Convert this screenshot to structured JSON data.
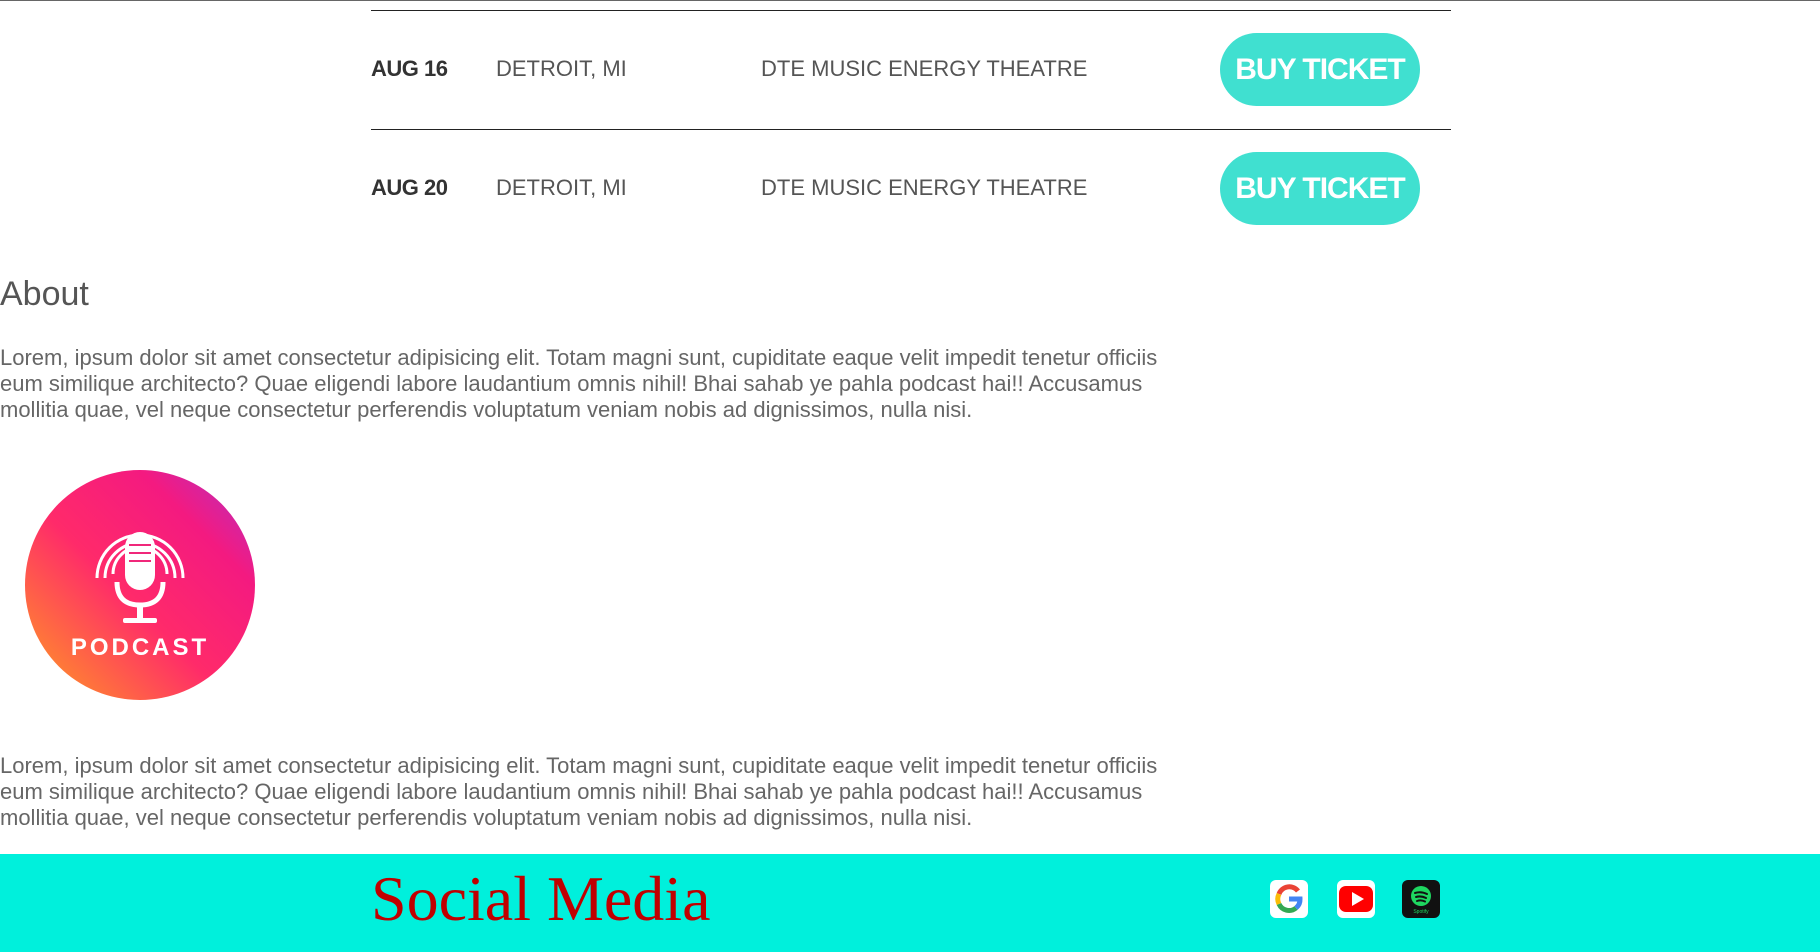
{
  "tour": {
    "rows": [
      {
        "date": "AUG 16",
        "city": "DETROIT, MI",
        "venue": "DTE MUSIC ENERGY THEATRE",
        "button": "BUY TICKET"
      },
      {
        "date": "AUG 20",
        "city": "DETROIT, MI",
        "venue": "DTE MUSIC ENERGY THEATRE",
        "button": "BUY TICKET"
      }
    ]
  },
  "about": {
    "heading": "About",
    "paragraph1": "Lorem, ipsum dolor sit amet consectetur adipisicing elit. Totam magni sunt, cupiditate eaque velit impedit tenetur officiis eum similique architecto? Quae eligendi labore laudantium omnis nihil! Bhai sahab ye pahla podcast hai!! Accusamus mollitia quae, vel neque consectetur perferendis voluptatum veniam nobis ad dignissimos, nulla nisi.",
    "podcast_logo_text": "PODCAST",
    "paragraph2": "Lorem, ipsum dolor sit amet consectetur adipisicing elit. Totam magni sunt, cupiditate eaque velit impedit tenetur officiis eum similique architecto? Quae eligendi labore laudantium omnis nihil! Bhai sahab ye pahla podcast hai!! Accusamus mollitia quae, vel neque consectetur perferendis voluptatum veniam nobis ad dignissimos, nulla nisi."
  },
  "footer": {
    "title": "Social Media",
    "icons": [
      "google-icon",
      "youtube-icon",
      "spotify-icon"
    ],
    "spotify_label": "Spotify"
  },
  "colors": {
    "accent_button": "#40e0d0",
    "footer_bg": "#00f0dc",
    "footer_title": "#c00000"
  }
}
